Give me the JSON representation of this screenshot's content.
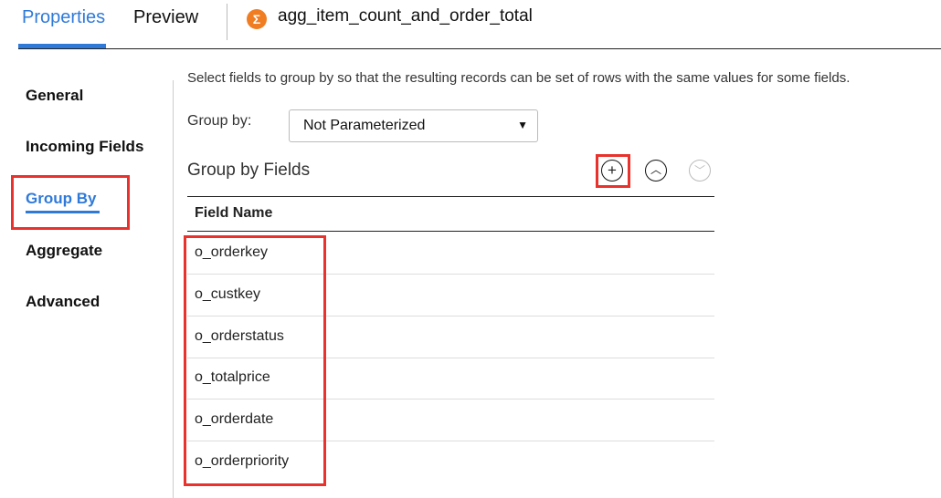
{
  "tabs": {
    "properties": "Properties",
    "preview": "Preview"
  },
  "transformation": {
    "icon": "sigma-icon",
    "name": "agg_item_count_and_order_total",
    "icon_color": "#f07d22"
  },
  "nav": [
    "General",
    "Incoming Fields",
    "Group By",
    "Aggregate",
    "Advanced"
  ],
  "main": {
    "description": "Select fields to group by so that the resulting records can be set of rows with the same values for some fields.",
    "group_by_label": "Group by:",
    "group_by_value": "Not Parameterized",
    "section_title": "Group by Fields",
    "column_header": "Field Name",
    "fields": [
      "o_orderkey",
      "o_custkey",
      "o_orderstatus",
      "o_totalprice",
      "o_orderdate",
      "o_orderpriority"
    ]
  },
  "colors": {
    "accent": "#2f7ad9",
    "highlight": "#e8322b"
  }
}
